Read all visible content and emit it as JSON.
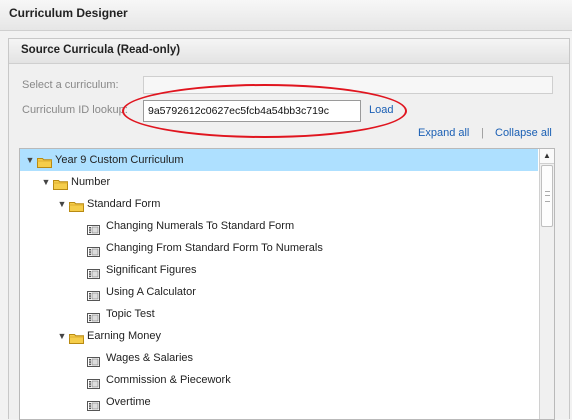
{
  "app": {
    "title": "Curriculum Designer"
  },
  "panel": {
    "title": "Source Curricula (Read-only)"
  },
  "form": {
    "select_label": "Select a curriculum:",
    "select_value": "",
    "lookup_label": "Curriculum ID lookup:",
    "lookup_value": "9a5792612c0627ec5fcb4a54bb3c719c",
    "load_label": "Load"
  },
  "tree_actions": {
    "expand_all": "Expand all",
    "separator": "|",
    "collapse_all": "Collapse all"
  },
  "tree": {
    "expand_glyph": "▼",
    "rows": [
      {
        "label": "Year 9 Custom Curriculum",
        "type": "folder",
        "expanded": true,
        "selected": true
      },
      {
        "label": "Number",
        "type": "folder",
        "expanded": true
      },
      {
        "label": "Standard Form",
        "type": "folder",
        "expanded": true
      },
      {
        "label": "Changing Numerals To Standard Form",
        "type": "lesson"
      },
      {
        "label": "Changing From Standard Form To Numerals",
        "type": "lesson"
      },
      {
        "label": "Significant Figures",
        "type": "lesson"
      },
      {
        "label": "Using A Calculator",
        "type": "lesson"
      },
      {
        "label": "Topic Test",
        "type": "lesson"
      },
      {
        "label": "Earning Money",
        "type": "folder",
        "expanded": true
      },
      {
        "label": "Wages & Salaries",
        "type": "lesson"
      },
      {
        "label": "Commission & Piecework",
        "type": "lesson"
      },
      {
        "label": "Overtime",
        "type": "lesson"
      }
    ]
  },
  "colors": {
    "selection": "#aee0ff",
    "link": "#1a5fb4",
    "highlight_ring": "#e0151f",
    "folder": "#f5cd4a"
  }
}
